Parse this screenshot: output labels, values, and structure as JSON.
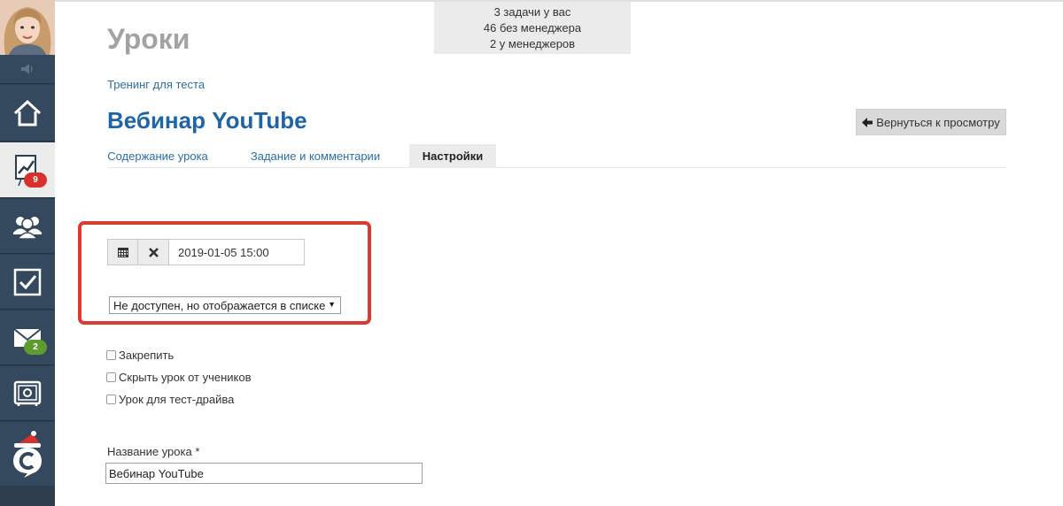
{
  "sidebar": {
    "items": [
      {
        "name": "home-icon",
        "badge": ""
      },
      {
        "name": "chart-icon",
        "badge": "9",
        "badge_color": "#d8312c"
      },
      {
        "name": "users-icon",
        "badge": ""
      },
      {
        "name": "tasks-icon",
        "badge": ""
      },
      {
        "name": "mail-icon",
        "badge": "2",
        "badge_color": "#5e9c2f"
      },
      {
        "name": "safe-icon",
        "badge": ""
      },
      {
        "name": "brand-logo-icon",
        "badge": ""
      }
    ],
    "bg_color": "#34495e"
  },
  "stats": {
    "line1": "3 задачи у вас",
    "line2": "46 без менеджера",
    "line3": "2 у менеджеров"
  },
  "header": {
    "page_title": "Уроки",
    "breadcrumb": "Тренинг для теста",
    "lesson_title": "Вебинар YouTube",
    "back_button": "Вернуться к просмотру"
  },
  "tabs": [
    {
      "label": "Содержание урока",
      "active": false
    },
    {
      "label": "Задание и комментарии",
      "active": false
    },
    {
      "label": "Настройки",
      "active": true
    }
  ],
  "settings": {
    "datetime_value": "2019-01-05 15:00",
    "availability_selected": "Не доступен, но отображается в списке",
    "checkboxes": [
      {
        "label": "Закрепить",
        "checked": false
      },
      {
        "label": "Скрыть урок от учеников",
        "checked": false
      },
      {
        "label": "Урок для тест-драйва",
        "checked": false
      }
    ],
    "name_label": "Название урока *",
    "name_value": "Вебинар YouTube"
  },
  "colors": {
    "accent": "#1d65a6",
    "highlight": "#dc3b32"
  }
}
